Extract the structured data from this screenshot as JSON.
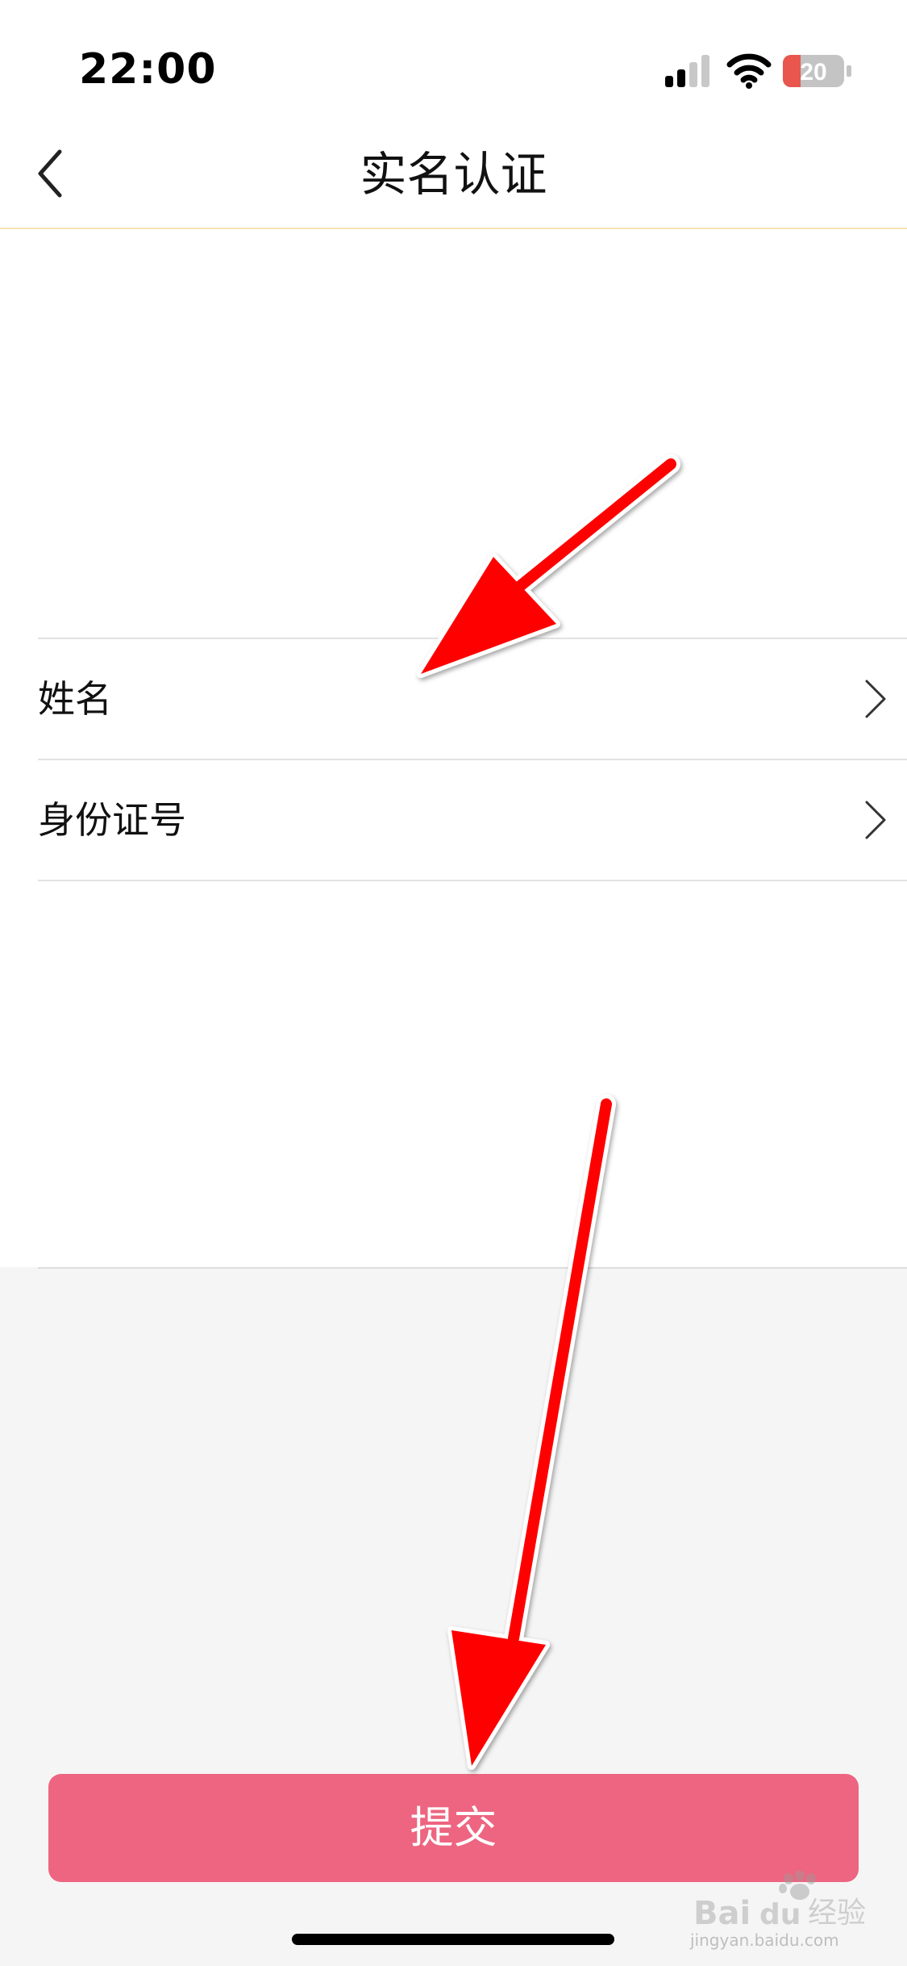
{
  "status_bar": {
    "time": "22:00",
    "battery_level": "20",
    "battery_color": "#e8564d",
    "icons": [
      "cellular-signal-icon",
      "wifi-icon",
      "battery-icon"
    ]
  },
  "nav": {
    "back_icon": "chevron-left-icon",
    "title": "实名认证",
    "divider_color": "#f7e2b0"
  },
  "form": {
    "rows": [
      {
        "label": "姓名",
        "icon": "chevron-right-icon"
      },
      {
        "label": "身份证号",
        "icon": "chevron-right-icon"
      }
    ]
  },
  "submit": {
    "label": "提交",
    "color": "#ed6580"
  },
  "annotations": {
    "arrow_color": "#ff0000",
    "count": 2
  },
  "watermark": {
    "logo": "Bai du 经验",
    "text": "jingyan.baidu.com"
  }
}
